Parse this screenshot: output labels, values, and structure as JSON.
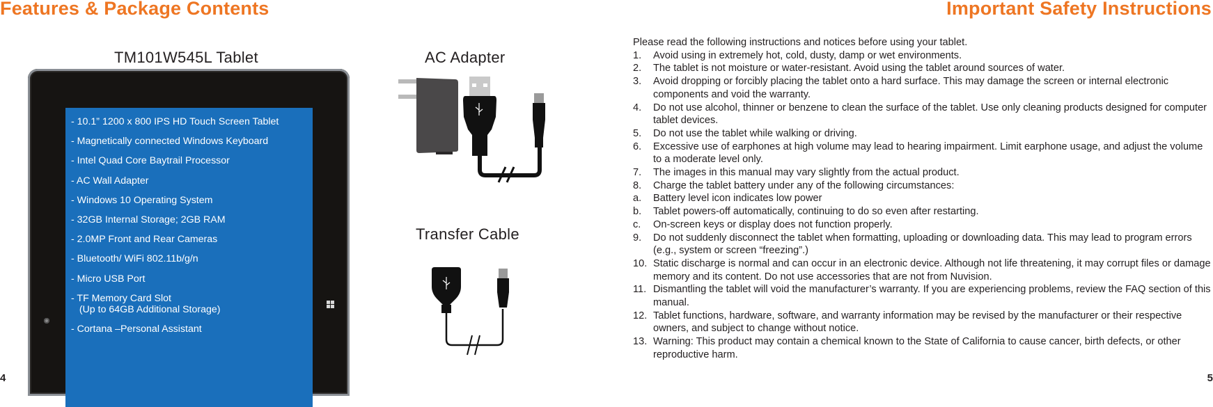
{
  "left_page": {
    "heading": "Features & Package Contents",
    "tablet_caption": "TM101W545L Tablet",
    "adapter_caption": "AC Adapter",
    "cable_caption": "Transfer Cable",
    "features": [
      "- 10.1” 1200 x 800 IPS HD Touch Screen Tablet",
      "- Magnetically connected Windows Keyboard",
      "- Intel Quad Core Baytrail Processor",
      "- AC Wall Adapter",
      "- Windows 10 Operating System",
      "- 32GB Internal Storage; 2GB RAM",
      "- 2.0MP Front and Rear Cameras",
      "- Bluetooth/ WiFi 802.11b/g/n",
      "- Micro USB Port",
      "- TF Memory Card Slot\n   (Up to 64GB Additional Storage)",
      "- Cortana –Personal Assistant"
    ],
    "page_number": "4"
  },
  "right_page": {
    "heading": "Important Safety Instructions",
    "intro": "Please read the following instructions and notices before using your tablet.",
    "items": [
      {
        "num": "1.",
        "text": "Avoid using in extremely hot, cold, dusty, damp or wet environments."
      },
      {
        "num": "2.",
        "text": "The tablet is not moisture or water-resistant. Avoid using the tablet around sources of water."
      },
      {
        "num": "3.",
        "text": "Avoid dropping or forcibly placing the tablet onto a hard surface. This may damage the screen or internal electronic components and void the warranty."
      },
      {
        "num": "4.",
        "text": "Do not use alcohol, thinner or benzene to clean the surface of the tablet. Use only cleaning products designed for computer tablet devices."
      },
      {
        "num": "5.",
        "text": "Do not use the tablet while walking or driving."
      },
      {
        "num": "6.",
        "text": "Excessive use of earphones at high volume may lead to hearing impairment. Limit earphone usage, and adjust the volume to a moderate level only."
      },
      {
        "num": "7.",
        "text": "The images in this manual may vary slightly from the actual product."
      },
      {
        "num": "8.",
        "text": "Charge the tablet battery under any of the following circumstances:"
      },
      {
        "num": "a.",
        "text": "Battery level icon indicates low power"
      },
      {
        "num": "b.",
        "text": "Tablet powers-off automatically, continuing to do so even after restarting."
      },
      {
        "num": "c.",
        "text": "On-screen keys or display does not function properly."
      },
      {
        "num": "9.",
        "text": "Do not suddenly disconnect the tablet when formatting, uploading or downloading data. This may lead to program errors (e.g., system or screen “freezing”.)"
      },
      {
        "num": "10.",
        "text": "Static discharge is normal and can occur in an electronic device. Although not life threatening, it may corrupt files or damage memory and its content. Do not use accessories that are not from Nuvision."
      },
      {
        "num": "11.",
        "text": "Dismantling the tablet will void the manufacturer’s warranty. If you are experiencing problems, review the FAQ section of this manual."
      },
      {
        "num": "12.",
        "text": "Tablet functions, hardware, software, and warranty information may be revised by the manufacturer or their respective owners, and subject to change without notice."
      },
      {
        "num": "13.",
        "text": "Warning: This product may contain a chemical known to the State of California to cause cancer, birth defects, or other reproductive harm."
      }
    ],
    "page_number": "5"
  },
  "colors": {
    "heading_orange": "#ee7623",
    "screen_blue": "#1a6fbb",
    "body_text": "#231f20"
  },
  "icons": {
    "tablet": "tablet-illustration",
    "adapter": "wall-adapter-illustration",
    "usb": "usb-symbol-icon",
    "windows": "windows-logo-icon",
    "camera": "camera-icon"
  }
}
